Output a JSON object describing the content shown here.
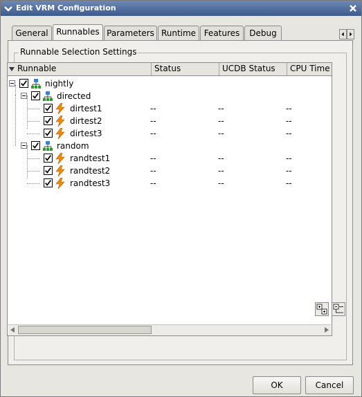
{
  "window": {
    "title": "Edit VRM Configuration"
  },
  "tabs": [
    {
      "label": "General"
    },
    {
      "label": "Runnables"
    },
    {
      "label": "Parameters"
    },
    {
      "label": "Runtime"
    },
    {
      "label": "Features"
    },
    {
      "label": "Debug"
    }
  ],
  "active_tab": "Runnables",
  "group": {
    "title": "Runnable Selection Settings"
  },
  "table": {
    "columns": [
      "Runnable",
      "Status",
      "UCDB Status",
      "CPU Time"
    ],
    "rows": [
      {
        "name": "nightly",
        "type": "group",
        "checked": true,
        "status": "",
        "ucdb": "",
        "cpu": ""
      },
      {
        "name": "directed",
        "type": "group",
        "checked": true,
        "status": "",
        "ucdb": "",
        "cpu": ""
      },
      {
        "name": "dirtest1",
        "type": "test",
        "checked": true,
        "status": "--",
        "ucdb": "--",
        "cpu": "--"
      },
      {
        "name": "dirtest2",
        "type": "test",
        "checked": true,
        "status": "--",
        "ucdb": "--",
        "cpu": "--"
      },
      {
        "name": "dirtest3",
        "type": "test",
        "checked": true,
        "status": "--",
        "ucdb": "--",
        "cpu": "--"
      },
      {
        "name": "random",
        "type": "group",
        "checked": true,
        "status": "",
        "ucdb": "",
        "cpu": ""
      },
      {
        "name": "randtest1",
        "type": "test",
        "checked": true,
        "status": "--",
        "ucdb": "--",
        "cpu": "--"
      },
      {
        "name": "randtest2",
        "type": "test",
        "checked": true,
        "status": "--",
        "ucdb": "--",
        "cpu": "--"
      },
      {
        "name": "randtest3",
        "type": "test",
        "checked": true,
        "status": "--",
        "ucdb": "--",
        "cpu": "--"
      }
    ]
  },
  "buttons": {
    "ok": "OK",
    "cancel": "Cancel"
  },
  "icons": {
    "group": "hierarchy-icon",
    "test": "lightning-icon"
  },
  "colors": {
    "titlebar": "#4a6797",
    "group_icon": "#2a7a2a",
    "test_icon": "#f08a00"
  }
}
